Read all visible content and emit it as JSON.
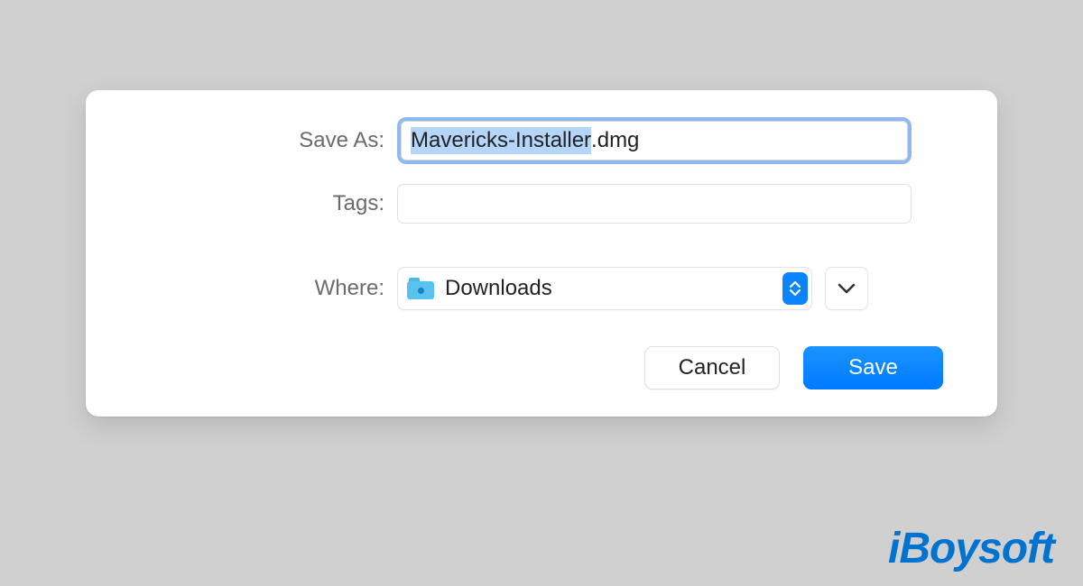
{
  "dialog": {
    "saveAs": {
      "label": "Save As:",
      "value_selected": "Mavericks-Installer",
      "value_rest": ".dmg"
    },
    "tags": {
      "label": "Tags:",
      "value": ""
    },
    "where": {
      "label": "Where:",
      "folder": "Downloads"
    },
    "buttons": {
      "cancel": "Cancel",
      "save": "Save"
    }
  },
  "watermark": "iBoysoft"
}
